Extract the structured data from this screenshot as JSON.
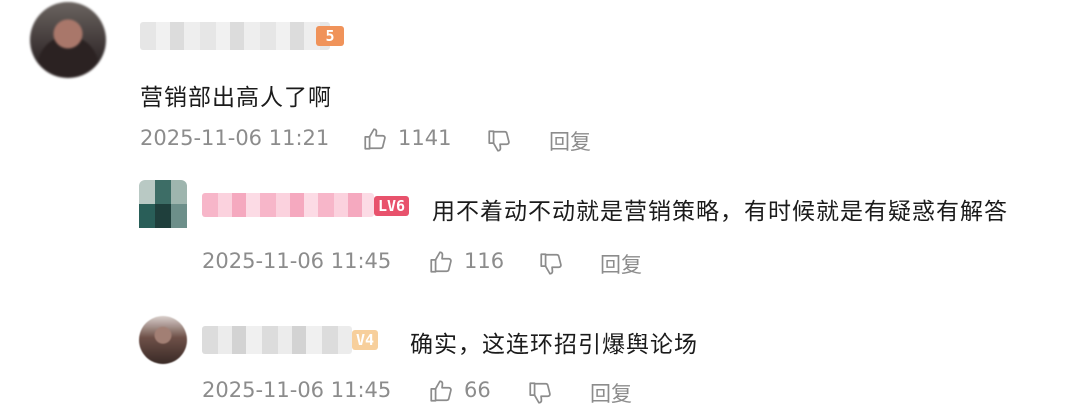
{
  "comments": [
    {
      "level_badge": "5",
      "text": "营销部出高人了啊",
      "time": "2025-11-06 11:21",
      "likes": "1141",
      "reply_label": "回复"
    }
  ],
  "replies": [
    {
      "level_badge": "LV6",
      "text": "用不着动不动就是营销策略，有时候就是有疑惑有解答",
      "time": "2025-11-06 11:45",
      "likes": "116",
      "reply_label": "回复"
    },
    {
      "level_badge": "V4",
      "text": "确实，这连环招引爆舆论场",
      "time": "2025-11-06 11:45",
      "likes": "66",
      "reply_label": "回复"
    }
  ],
  "icons": {
    "like": "thumbs-up-icon",
    "dislike": "thumbs-down-icon"
  },
  "colors": {
    "meta_text": "#8c8c8c",
    "lv_badge_main": "#f0935a",
    "lv_badge_reply1": "#e8526c",
    "lv_badge_reply2": "#f7cf9c"
  }
}
